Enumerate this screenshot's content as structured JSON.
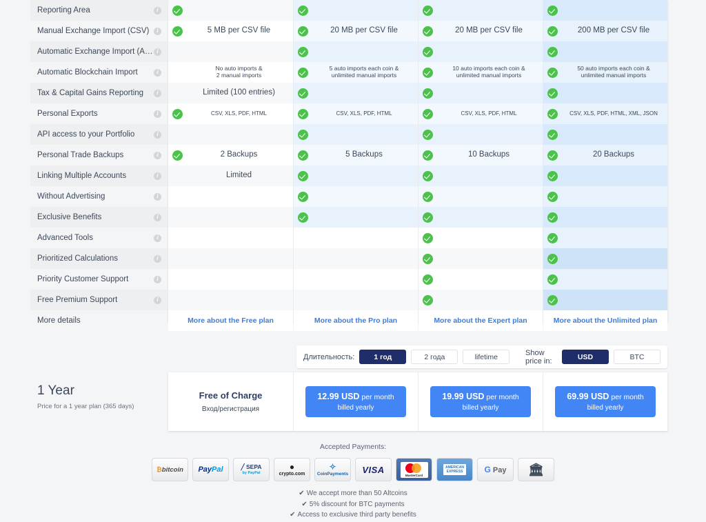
{
  "table": {
    "features": [
      {
        "label": "Reporting Area",
        "info": "i"
      },
      {
        "label": "Manual Exchange Import (CSV)",
        "info": "i"
      },
      {
        "label": "Automatic Exchange Import (API)",
        "info": "i"
      },
      {
        "label": "Automatic Blockchain Import",
        "info": "i"
      },
      {
        "label": "Tax & Capital Gains Reporting",
        "info": "i"
      },
      {
        "label": "Personal Exports",
        "info": "i"
      },
      {
        "label": "API access to your Portfolio",
        "info": "i"
      },
      {
        "label": "Personal Trade Backups",
        "info": "i"
      },
      {
        "label": "Linking Multiple Accounts",
        "info": "i"
      },
      {
        "label": "Without Advertising",
        "info": "i"
      },
      {
        "label": "Exclusive Benefits",
        "info": "i"
      },
      {
        "label": "Advanced Tools",
        "info": "i"
      },
      {
        "label": "Prioritized Calculations",
        "info": "i"
      },
      {
        "label": "Priority Customer Support",
        "info": "i"
      },
      {
        "label": "Free Premium Support",
        "info": "i"
      },
      {
        "label": "More details",
        "info": ""
      }
    ],
    "plans": [
      {
        "name": "Free",
        "more_link": "More about the Free plan",
        "cells": [
          {
            "check": true,
            "text": ""
          },
          {
            "check": true,
            "text": "5 MB per CSV file",
            "size": "big"
          },
          {
            "check": false,
            "text": ""
          },
          {
            "check": false,
            "text": "No auto imports &\n2 manual imports",
            "size": "two"
          },
          {
            "check": false,
            "text": "Limited (100 entries)",
            "size": "big"
          },
          {
            "check": true,
            "text": "CSV, XLS, PDF, HTML",
            "size": "small"
          },
          {
            "check": false,
            "text": ""
          },
          {
            "check": true,
            "text": "2 Backups",
            "size": "big"
          },
          {
            "check": false,
            "text": "Limited",
            "size": "big"
          },
          {
            "check": false,
            "text": ""
          },
          {
            "check": false,
            "text": ""
          },
          {
            "check": false,
            "text": ""
          },
          {
            "check": false,
            "text": ""
          },
          {
            "check": false,
            "text": ""
          },
          {
            "check": false,
            "text": ""
          }
        ]
      },
      {
        "name": "Pro",
        "more_link": "More about the Pro plan",
        "cells": [
          {
            "check": true,
            "text": ""
          },
          {
            "check": true,
            "text": "20 MB per CSV file",
            "size": "big"
          },
          {
            "check": true,
            "text": ""
          },
          {
            "check": true,
            "text": "5 auto imports each coin &\nunlimited manual imports",
            "size": "two"
          },
          {
            "check": true,
            "text": ""
          },
          {
            "check": true,
            "text": "CSV, XLS, PDF, HTML",
            "size": "small"
          },
          {
            "check": true,
            "text": ""
          },
          {
            "check": true,
            "text": "5 Backups",
            "size": "big"
          },
          {
            "check": true,
            "text": ""
          },
          {
            "check": true,
            "text": ""
          },
          {
            "check": true,
            "text": ""
          },
          {
            "check": false,
            "text": ""
          },
          {
            "check": false,
            "text": ""
          },
          {
            "check": false,
            "text": ""
          },
          {
            "check": false,
            "text": ""
          }
        ]
      },
      {
        "name": "Expert",
        "more_link": "More about the Expert plan",
        "cells": [
          {
            "check": true,
            "text": ""
          },
          {
            "check": true,
            "text": "20 MB per CSV file",
            "size": "big"
          },
          {
            "check": true,
            "text": ""
          },
          {
            "check": true,
            "text": "10 auto imports each coin &\nunlimited manual imports",
            "size": "two"
          },
          {
            "check": true,
            "text": ""
          },
          {
            "check": true,
            "text": "CSV, XLS, PDF, HTML",
            "size": "small"
          },
          {
            "check": true,
            "text": ""
          },
          {
            "check": true,
            "text": "10 Backups",
            "size": "big"
          },
          {
            "check": true,
            "text": ""
          },
          {
            "check": true,
            "text": ""
          },
          {
            "check": true,
            "text": ""
          },
          {
            "check": true,
            "text": ""
          },
          {
            "check": true,
            "text": ""
          },
          {
            "check": true,
            "text": ""
          },
          {
            "check": true,
            "text": ""
          }
        ]
      },
      {
        "name": "Unlimited",
        "more_link": "More about the Unlimited plan",
        "cells": [
          {
            "check": true,
            "text": ""
          },
          {
            "check": true,
            "text": "200 MB per CSV file",
            "size": "big"
          },
          {
            "check": true,
            "text": ""
          },
          {
            "check": true,
            "text": "50 auto imports each coin &\nunlimited manual imports",
            "size": "two"
          },
          {
            "check": true,
            "text": ""
          },
          {
            "check": true,
            "text": "CSV, XLS, PDF, HTML, XML, JSON",
            "size": "small"
          },
          {
            "check": true,
            "text": ""
          },
          {
            "check": true,
            "text": "20 Backups",
            "size": "big"
          },
          {
            "check": true,
            "text": ""
          },
          {
            "check": true,
            "text": ""
          },
          {
            "check": true,
            "text": ""
          },
          {
            "check": true,
            "text": ""
          },
          {
            "check": true,
            "text": ""
          },
          {
            "check": true,
            "text": ""
          },
          {
            "check": true,
            "text": ""
          }
        ]
      }
    ]
  },
  "options": {
    "duration_label": "Длительность:",
    "durations": [
      {
        "label": "1 год",
        "active": true
      },
      {
        "label": "2 года",
        "active": false
      },
      {
        "label": "lifetime",
        "active": false
      }
    ],
    "currency_label": "Show price in:",
    "currencies": [
      {
        "label": "USD",
        "active": true
      },
      {
        "label": "BTC",
        "active": false
      }
    ]
  },
  "pricing": {
    "period_title": "1 Year",
    "period_sub": "Price for a 1 year plan (365 days)",
    "cards": [
      {
        "kind": "free",
        "title": "Free of Charge",
        "sub": "Вход/регистрация"
      },
      {
        "kind": "paid",
        "price": "12.99 USD",
        "per": " per month",
        "billing": "billed yearly"
      },
      {
        "kind": "paid",
        "price": "19.99 USD",
        "per": " per month",
        "billing": "billed yearly"
      },
      {
        "kind": "paid",
        "price": "69.99 USD",
        "per": " per month",
        "billing": "billed yearly"
      }
    ]
  },
  "payments": {
    "title": "Accepted Payments:",
    "methods": [
      {
        "name": "bitcoin",
        "icon": "bitcoin-logo"
      },
      {
        "name": "PayPal",
        "icon": "paypal-logo"
      },
      {
        "name": "SEPA by PayPal",
        "icon": "sepa-logo"
      },
      {
        "name": "crypto.com",
        "icon": "cryptocom-logo"
      },
      {
        "name": "CoinPayments",
        "icon": "coinpayments-logo"
      },
      {
        "name": "VISA",
        "icon": "visa-logo"
      },
      {
        "name": "MasterCard",
        "icon": "mastercard-logo"
      },
      {
        "name": "AMERICAN EXPRESS",
        "icon": "amex-logo"
      },
      {
        "name": "G Pay",
        "icon": "gpay-logo"
      },
      {
        "name": "Bank Transfer",
        "icon": "bank-logo"
      }
    ],
    "notes": [
      "We accept more than 50 Altcoins",
      "5% discount for BTC payments",
      "Access to exclusive third party benefits"
    ],
    "tick": "✔"
  },
  "colors": {
    "accent_blue": "#4285f4",
    "dark_navy": "#1f2d6b",
    "check_green": "#4cc14c",
    "link_blue": "#3b7ddd"
  }
}
